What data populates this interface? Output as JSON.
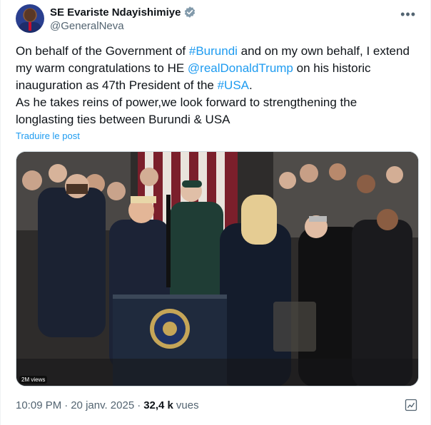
{
  "author": {
    "display_name": "SE Evariste Ndayishimiye",
    "handle": "@GeneralNeva",
    "verified": true
  },
  "more_icon": "more-horizontal-icon",
  "tweet": {
    "segments": [
      {
        "text": "On behalf of the Government of ",
        "link": false
      },
      {
        "text": "#Burundi",
        "link": true
      },
      {
        "text": " and on my own behalf, I extend my warm congratulations to HE ",
        "link": false
      },
      {
        "text": "@realDonaldTrump",
        "link": true
      },
      {
        "text": " on his historic inauguration as 47th President of the ",
        "link": false
      },
      {
        "text": "#USA",
        "link": true
      },
      {
        "text": ".",
        "link": false
      },
      {
        "text": "\nAs he takes reins of power,we look forward to strengthening the longlasting ties between Burundi & USA",
        "link": false
      }
    ]
  },
  "translate_label": "Traduire le post",
  "media": {
    "views_badge": "2M views"
  },
  "meta": {
    "time": "10:09 PM",
    "sep1": "·",
    "date": "20 janv. 2025",
    "sep2": "·",
    "views_count": "32,4 k",
    "views_label": "vues"
  },
  "colors": {
    "link": "#1d9bf0",
    "muted": "#536471",
    "verified": "#829aab"
  }
}
